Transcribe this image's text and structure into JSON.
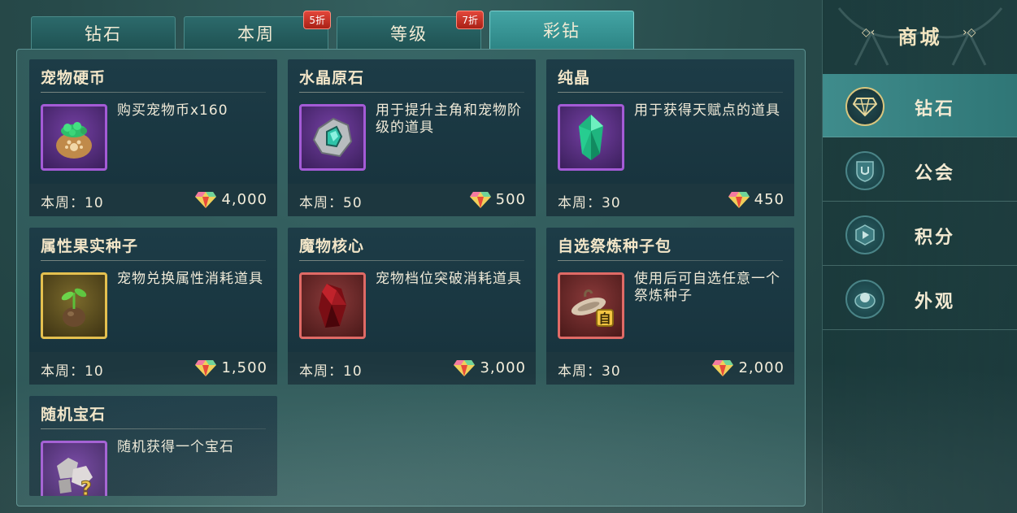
{
  "tabs": [
    {
      "label": "钻石",
      "badge": ""
    },
    {
      "label": "本周",
      "badge": "5折"
    },
    {
      "label": "等级",
      "badge": "7折"
    },
    {
      "label": "彩钻",
      "badge": ""
    }
  ],
  "items": [
    {
      "title": "宠物硬币",
      "desc": "购买宠物币x160",
      "weekly": "本周：10",
      "price": "4,000",
      "icon": "pet-coin-bag-icon",
      "rarity": "purple"
    },
    {
      "title": "水晶原石",
      "desc": "用于提升主角和宠物阶级的道具",
      "weekly": "本周：50",
      "price": "500",
      "icon": "crystal-ore-icon",
      "rarity": "purple"
    },
    {
      "title": "纯晶",
      "desc": "用于获得天赋点的道具",
      "weekly": "本周：30",
      "price": "450",
      "icon": "pure-crystal-icon",
      "rarity": "purple"
    },
    {
      "title": "属性果实种子",
      "desc": "宠物兑换属性消耗道具",
      "weekly": "本周：10",
      "price": "1,500",
      "icon": "seed-sprout-icon",
      "rarity": "gold"
    },
    {
      "title": "魔物核心",
      "desc": "宠物档位突破消耗道具",
      "weekly": "本周：10",
      "price": "3,000",
      "icon": "monster-core-icon",
      "rarity": "red"
    },
    {
      "title": "自选祭炼种子包",
      "desc": "使用后可自选任意一个祭炼种子",
      "weekly": "本周：30",
      "price": "2,000",
      "icon": "seed-pack-icon",
      "rarity": "red"
    },
    {
      "title": "随机宝石",
      "desc": "随机获得一个宝石",
      "weekly": "",
      "price": "",
      "icon": "random-gem-icon",
      "rarity": "purple"
    }
  ],
  "sidebar": {
    "title": "商城",
    "items": [
      {
        "label": "钻石",
        "icon": "diamond-icon"
      },
      {
        "label": "公会",
        "icon": "guild-shield-icon"
      },
      {
        "label": "积分",
        "icon": "points-hexagon-icon"
      },
      {
        "label": "外观",
        "icon": "appearance-icon"
      }
    ]
  },
  "colors": {
    "accent_tab": "#3a9898",
    "badge_red": "#c8352a",
    "rarity_purple": "#a45bd6",
    "rarity_gold": "#e4c04f",
    "rarity_red": "#e06a66"
  }
}
